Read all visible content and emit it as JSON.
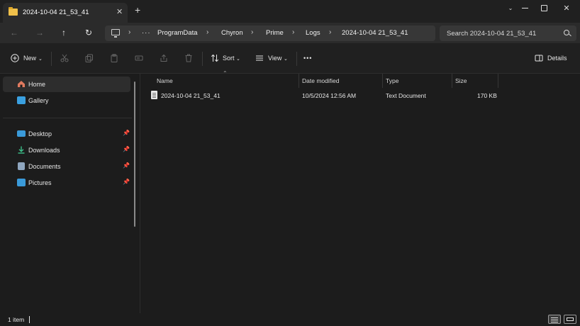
{
  "window": {
    "tab_title": "2024-10-04 21_53_41",
    "new_tab": "+",
    "tab_close": "✕"
  },
  "nav": {
    "ellipsis": "···",
    "breadcrumbs": [
      "ProgramData",
      "Chyron",
      "Prime",
      "Logs",
      "2024-10-04 21_53_41"
    ],
    "search_placeholder": "Search 2024-10-04 21_53_41"
  },
  "toolbar": {
    "new_label": "New",
    "sort_label": "Sort",
    "view_label": "View",
    "more_label": "•••",
    "details_label": "Details"
  },
  "sidebar": {
    "items": [
      {
        "label": "Home",
        "icon": "home-icon",
        "color": "#e07a5f"
      },
      {
        "label": "Gallery",
        "icon": "gallery-icon",
        "color": "#3aa0e0"
      },
      {
        "label": "Desktop",
        "icon": "desktop-icon",
        "color": "#3a9ad9",
        "pinned": true
      },
      {
        "label": "Downloads",
        "icon": "downloads-icon",
        "color": "#3dbf8a",
        "pinned": true
      },
      {
        "label": "Documents",
        "icon": "documents-icon",
        "color": "#8fa6bf",
        "pinned": true
      },
      {
        "label": "Pictures",
        "icon": "pictures-icon",
        "color": "#3a9ad9",
        "pinned": true
      }
    ]
  },
  "filelist": {
    "columns": [
      "Name",
      "Date modified",
      "Type",
      "Size"
    ],
    "rows": [
      {
        "name": "2024-10-04 21_53_41",
        "date": "10/5/2024 12:56 AM",
        "type": "Text Document",
        "size": "170 KB"
      }
    ]
  },
  "status": {
    "count": "1 item"
  },
  "colors": {
    "background": "#1c1c1c",
    "titlebar": "#202020",
    "address_bg": "#373737",
    "folder": "#f0c04a"
  }
}
